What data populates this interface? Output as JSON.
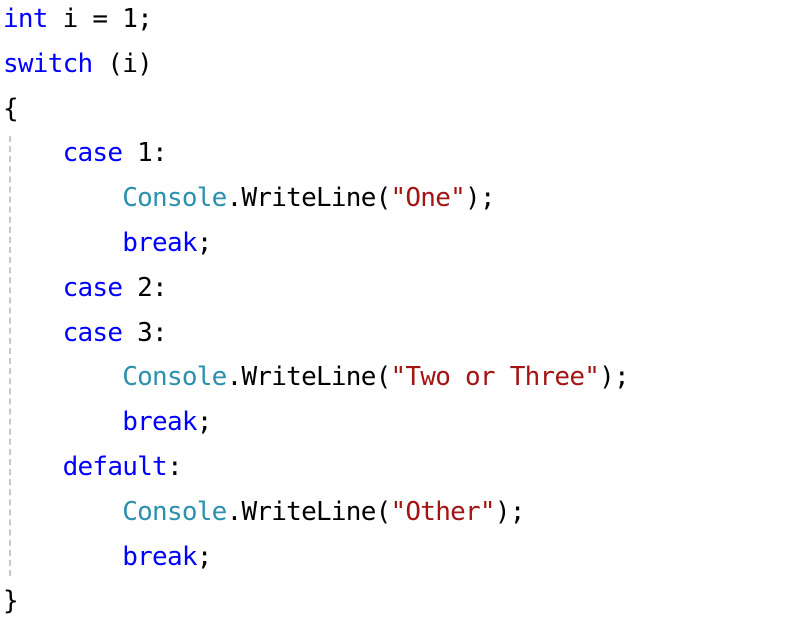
{
  "editor": {
    "language": "csharp",
    "colors": {
      "keyword": "#0000ff",
      "type": "#2b91af",
      "string": "#a31515",
      "plain": "#000000",
      "indent_guide": "#c8c8c8",
      "background": "#ffffff"
    },
    "lines": [
      [
        {
          "text": "int",
          "kind": "keyword"
        },
        {
          "text": " i = 1;",
          "kind": "plain"
        }
      ],
      [
        {
          "text": "switch",
          "kind": "keyword"
        },
        {
          "text": " (i)",
          "kind": "plain"
        }
      ],
      [
        {
          "text": "{",
          "kind": "plain"
        }
      ],
      [
        {
          "text": "    ",
          "kind": "plain"
        },
        {
          "text": "case",
          "kind": "keyword"
        },
        {
          "text": " 1:",
          "kind": "plain"
        }
      ],
      [
        {
          "text": "        ",
          "kind": "plain"
        },
        {
          "text": "Console",
          "kind": "type"
        },
        {
          "text": ".WriteLine(",
          "kind": "plain"
        },
        {
          "text": "\"One\"",
          "kind": "string"
        },
        {
          "text": ");",
          "kind": "plain"
        }
      ],
      [
        {
          "text": "        ",
          "kind": "plain"
        },
        {
          "text": "break",
          "kind": "keyword"
        },
        {
          "text": ";",
          "kind": "plain"
        }
      ],
      [
        {
          "text": "    ",
          "kind": "plain"
        },
        {
          "text": "case",
          "kind": "keyword"
        },
        {
          "text": " 2:",
          "kind": "plain"
        }
      ],
      [
        {
          "text": "    ",
          "kind": "plain"
        },
        {
          "text": "case",
          "kind": "keyword"
        },
        {
          "text": " 3:",
          "kind": "plain"
        }
      ],
      [
        {
          "text": "        ",
          "kind": "plain"
        },
        {
          "text": "Console",
          "kind": "type"
        },
        {
          "text": ".WriteLine(",
          "kind": "plain"
        },
        {
          "text": "\"Two or Three\"",
          "kind": "string"
        },
        {
          "text": ");",
          "kind": "plain"
        }
      ],
      [
        {
          "text": "        ",
          "kind": "plain"
        },
        {
          "text": "break",
          "kind": "keyword"
        },
        {
          "text": ";",
          "kind": "plain"
        }
      ],
      [
        {
          "text": "    ",
          "kind": "plain"
        },
        {
          "text": "default",
          "kind": "keyword"
        },
        {
          "text": ":",
          "kind": "plain"
        }
      ],
      [
        {
          "text": "        ",
          "kind": "plain"
        },
        {
          "text": "Console",
          "kind": "type"
        },
        {
          "text": ".WriteLine(",
          "kind": "plain"
        },
        {
          "text": "\"Other\"",
          "kind": "string"
        },
        {
          "text": ");",
          "kind": "plain"
        }
      ],
      [
        {
          "text": "        ",
          "kind": "plain"
        },
        {
          "text": "break",
          "kind": "keyword"
        },
        {
          "text": ";",
          "kind": "plain"
        }
      ],
      [
        {
          "text": "}",
          "kind": "plain"
        }
      ]
    ]
  }
}
